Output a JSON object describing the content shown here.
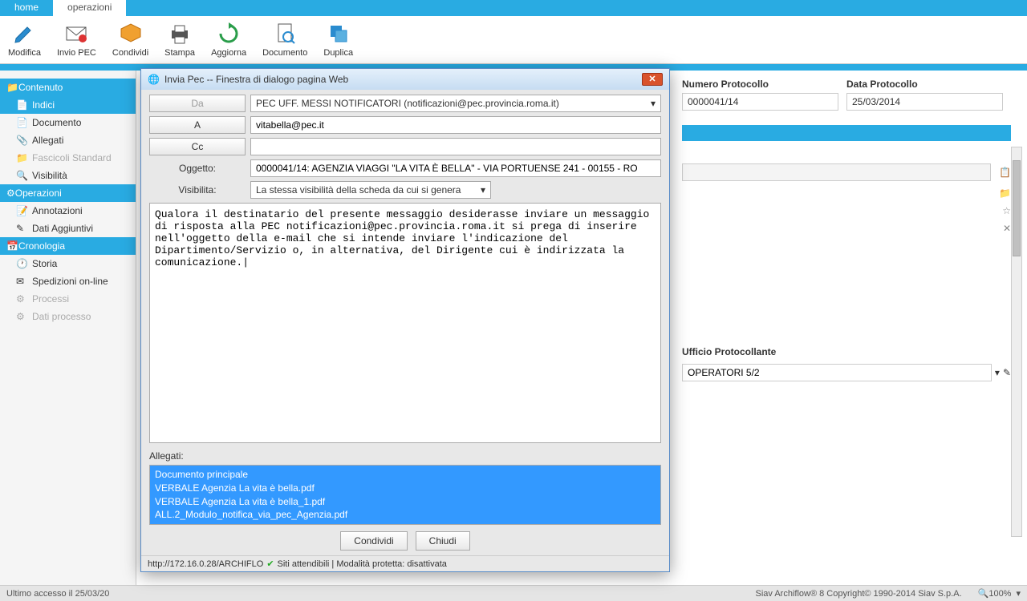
{
  "tabs": {
    "home": "home",
    "operazioni": "operazioni"
  },
  "toolbar": {
    "modifica": "Modifica",
    "invio_pec": "Invio PEC",
    "condividi": "Condividi",
    "stampa": "Stampa",
    "aggiorna": "Aggiorna",
    "documento": "Documento",
    "duplica": "Duplica"
  },
  "sidebar": {
    "contenuto": "Contenuto",
    "indici": "Indici",
    "documento": "Documento",
    "allegati": "Allegati",
    "fascicoli": "Fascicoli Standard",
    "visibilita": "Visibilità",
    "operazioni": "Operazioni",
    "annotazioni": "Annotazioni",
    "dati_aggiuntivi": "Dati Aggiuntivi",
    "cronologia": "Cronologia",
    "storia": "Storia",
    "spedizioni": "Spedizioni on-line",
    "processi": "Processi",
    "dati_processo": "Dati processo"
  },
  "content": {
    "numero_label": "Numero Protocollo",
    "numero_val": "0000041/14",
    "data_label": "Data Protocollo",
    "data_val": "25/03/2014",
    "ufficio_label": "Ufficio Protocollante",
    "ufficio_val": "OPERATORI 5/2"
  },
  "dialog": {
    "title": "Invia Pec -- Finestra di dialogo pagina Web",
    "da_label": "Da",
    "da_val": "PEC UFF. MESSI NOTIFICATORI (notificazioni@pec.provincia.roma.it)",
    "a_label": "A",
    "a_val": "vitabella@pec.it",
    "cc_label": "Cc",
    "cc_val": "",
    "oggetto_label": "Oggetto:",
    "oggetto_val": "0000041/14: AGENZIA VIAGGI \"LA VITA È BELLA\" - VIA PORTUENSE 241 - 00155 - RO",
    "visibilita_label": "Visibilita:",
    "visibilita_val": "La stessa visibilità della scheda da cui si genera",
    "body": "Qualora il destinatario del presente messaggio desiderasse inviare un messaggio di risposta alla PEC notificazioni@pec.provincia.roma.it si prega di inserire nell'oggetto della e-mail che si intende inviare l'indicazione del Dipartimento/Servizio o, in alternativa, del Dirigente cui è indirizzata la comunicazione.|",
    "allegati_label": "Allegati:",
    "allegati": [
      "Documento principale",
      "VERBALE Agenzia La vita è bella.pdf",
      "VERBALE Agenzia La vita è bella_1.pdf",
      "ALL.2_Modulo_notifica_via_pec_Agenzia.pdf"
    ],
    "condividi_btn": "Condividi",
    "chiudi_btn": "Chiudi",
    "status_url": "http://172.16.0.28/ARCHIFLO",
    "status_text": "Siti attendibili | Modalità protetta: disattivata"
  },
  "statusbar": {
    "left": "Ultimo accesso il 25/03/20",
    "right": "Siav Archiflow® 8 Copyright© 1990-2014 Siav S.p.A.",
    "zoom": "100%"
  }
}
